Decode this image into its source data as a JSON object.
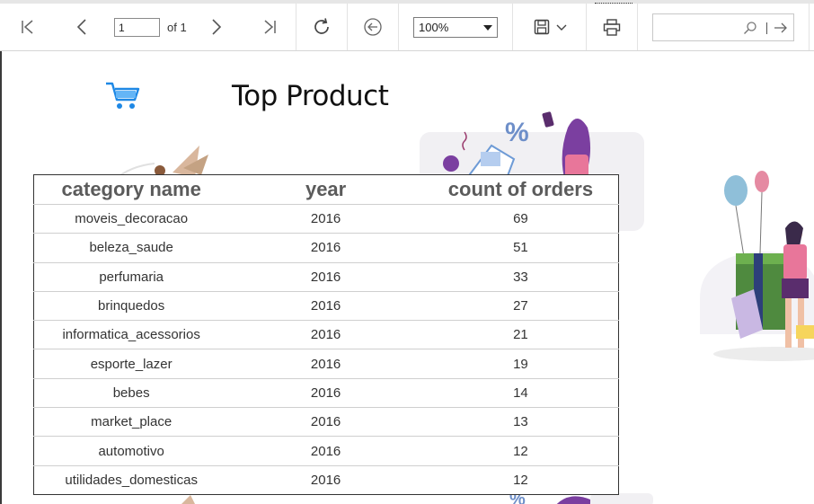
{
  "toolbar": {
    "page_current": "1",
    "page_of": "of 1",
    "zoom": "100%",
    "search_value": "",
    "icons": [
      "first-page-icon",
      "previous-page-icon",
      "next-page-icon",
      "last-page-icon",
      "refresh-icon",
      "back-icon",
      "save-icon",
      "print-icon",
      "search-icon",
      "go-icon"
    ]
  },
  "report": {
    "title": "Top Product",
    "table": {
      "headers": [
        "category name",
        "year",
        "count of orders"
      ],
      "rows": [
        [
          "moveis_decoracao",
          "2016",
          "69"
        ],
        [
          "beleza_saude",
          "2016",
          "51"
        ],
        [
          "perfumaria",
          "2016",
          "33"
        ],
        [
          "brinquedos",
          "2016",
          "27"
        ],
        [
          "informatica_acessorios",
          "2016",
          "21"
        ],
        [
          "esporte_lazer",
          "2016",
          "19"
        ],
        [
          "bebes",
          "2016",
          "14"
        ],
        [
          "market_place",
          "2016",
          "13"
        ],
        [
          "automotivo",
          "2016",
          "12"
        ],
        [
          "utilidades_domesticas",
          "2016",
          "12"
        ]
      ]
    }
  },
  "colors": {
    "accent": "#2196f3",
    "header_text": "#5b5b5b",
    "illustration_purple": "#7b3fa0",
    "illustration_pink": "#e8769a"
  }
}
